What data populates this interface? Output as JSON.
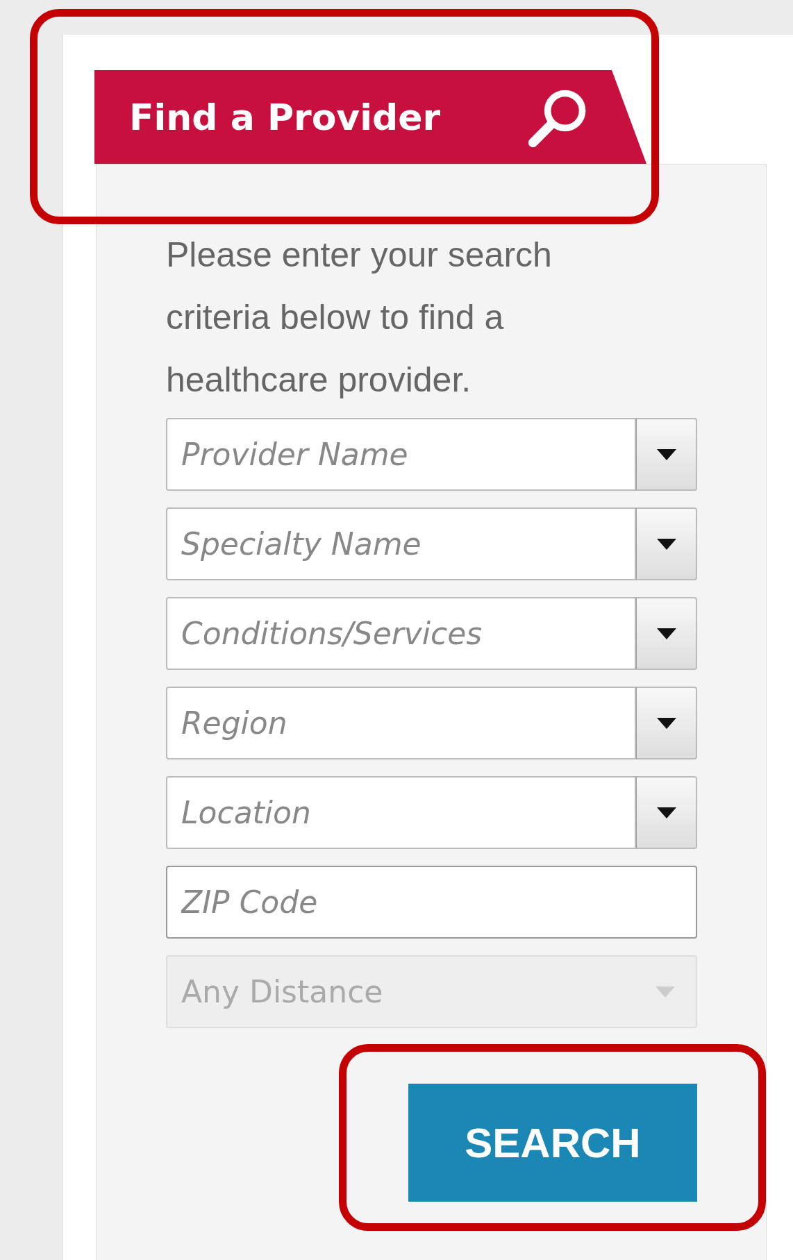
{
  "tab": {
    "label": "Find a Provider",
    "highlighted": true
  },
  "intro": "Please enter your search criteria below to find a healthcare provider.",
  "fields": [
    {
      "kind": "dropdown",
      "placeholder": "Provider Name",
      "disabled": false
    },
    {
      "kind": "dropdown",
      "placeholder": "Specialty Name",
      "disabled": false
    },
    {
      "kind": "dropdown",
      "placeholder": "Conditions/Services",
      "disabled": false
    },
    {
      "kind": "dropdown",
      "placeholder": "Region",
      "disabled": false
    },
    {
      "kind": "dropdown",
      "placeholder": "Location",
      "disabled": false
    },
    {
      "kind": "text",
      "placeholder": "ZIP Code",
      "disabled": false
    },
    {
      "kind": "select",
      "placeholder": "Any Distance",
      "disabled": true
    }
  ],
  "search_button": {
    "label": "SEARCH",
    "highlighted": true
  }
}
